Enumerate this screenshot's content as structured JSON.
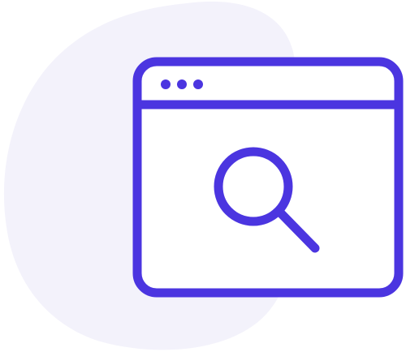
{
  "illustration": {
    "icon": "browser-window-search-icon",
    "colors": {
      "stroke": "#4B35E0",
      "blob": "#F3F2FB",
      "window_fill": "#FFFFFF",
      "background": "#FFFFFF"
    },
    "window_dot_count": 3
  }
}
